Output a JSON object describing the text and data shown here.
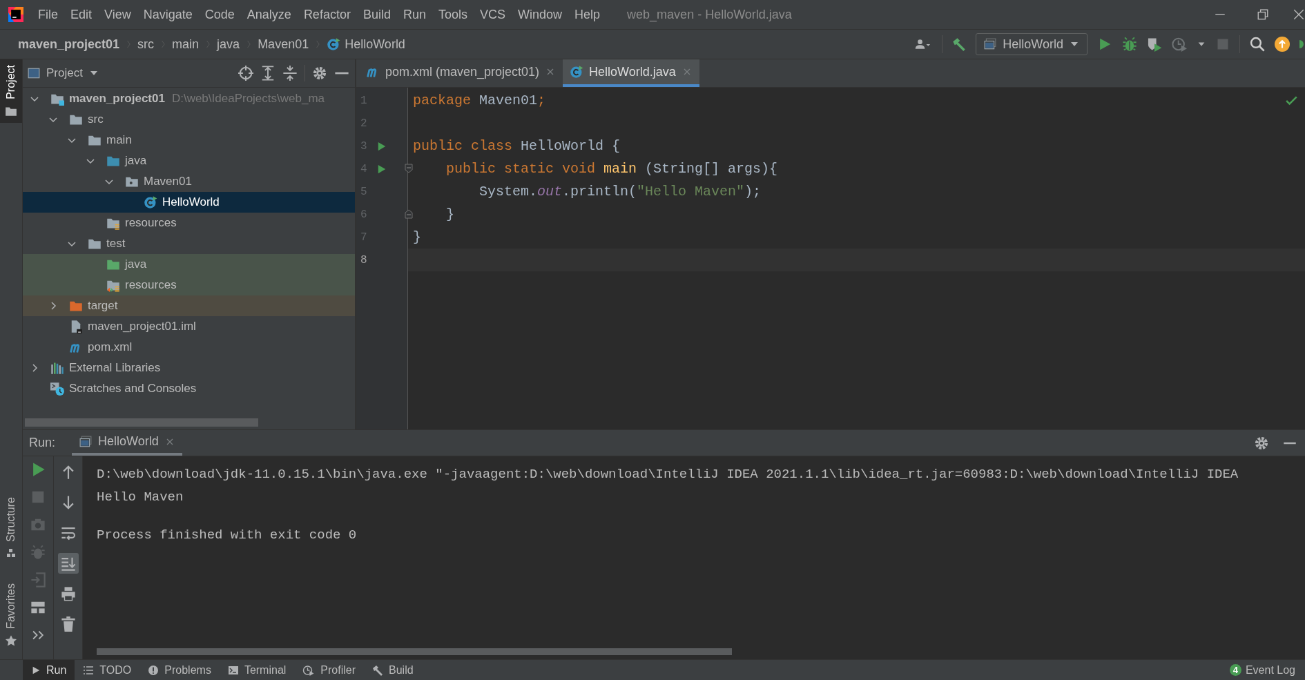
{
  "window": {
    "title": "web_maven - HelloWorld.java"
  },
  "menu": [
    "File",
    "Edit",
    "View",
    "Navigate",
    "Code",
    "Analyze",
    "Refactor",
    "Build",
    "Run",
    "Tools",
    "VCS",
    "Window",
    "Help"
  ],
  "breadcrumbs": [
    {
      "label": "maven_project01",
      "kind": "module"
    },
    {
      "label": "src",
      "kind": "folder"
    },
    {
      "label": "main",
      "kind": "folder"
    },
    {
      "label": "java",
      "kind": "folder"
    },
    {
      "label": "Maven01",
      "kind": "folder"
    },
    {
      "label": "HelloWorld",
      "kind": "class"
    }
  ],
  "toolbar": {
    "run_config": "HelloWorld"
  },
  "left_stripe": {
    "top": [
      {
        "label": "Project",
        "kind": "project",
        "selected": true
      }
    ],
    "bottom": [
      {
        "label": "Structure",
        "kind": "structure",
        "selected": false
      },
      {
        "label": "Favorites",
        "kind": "favorites",
        "selected": false
      }
    ]
  },
  "project_panel": {
    "title": "Project",
    "tree": [
      {
        "label": "maven_project01",
        "kind": "module",
        "path": "D:\\web\\IdeaProjects\\web_ma",
        "expanded": true,
        "selected": false,
        "children": [
          {
            "label": "src",
            "kind": "folder",
            "expanded": true,
            "selected": false,
            "children": [
              {
                "label": "main",
                "kind": "folder",
                "expanded": true,
                "selected": false,
                "children": [
                  {
                    "label": "java",
                    "kind": "source_root",
                    "expanded": true,
                    "selected": false,
                    "children": [
                      {
                        "label": "Maven01",
                        "kind": "package",
                        "expanded": true,
                        "selected": false,
                        "children": [
                          {
                            "label": "HelloWorld",
                            "kind": "class",
                            "selected": true
                          }
                        ]
                      }
                    ]
                  },
                  {
                    "label": "resources",
                    "kind": "resources_root",
                    "selected": false
                  }
                ]
              },
              {
                "label": "test",
                "kind": "folder",
                "expanded": true,
                "selected": false,
                "children": [
                  {
                    "label": "java",
                    "kind": "test_root",
                    "selected": false
                  },
                  {
                    "label": "resources",
                    "kind": "test_resources_root",
                    "selected": false
                  }
                ]
              }
            ]
          },
          {
            "label": "target",
            "kind": "excluded",
            "expanded": false,
            "selected": false
          },
          {
            "label": "maven_project01.iml",
            "kind": "iml",
            "selected": false
          },
          {
            "label": "pom.xml",
            "kind": "maven",
            "selected": false
          }
        ]
      },
      {
        "label": "External Libraries",
        "kind": "libraries",
        "expanded": false,
        "selected": false
      },
      {
        "label": "Scratches and Consoles",
        "kind": "scratches",
        "selected": false
      }
    ]
  },
  "editor": {
    "tabs": [
      {
        "label": "pom.xml (maven_project01)",
        "kind": "maven",
        "selected": false
      },
      {
        "label": "HelloWorld.java",
        "kind": "class",
        "selected": true
      }
    ],
    "lines": [
      {
        "number": "1",
        "run_marker": false,
        "current": false,
        "fold_start": false,
        "fold_end": false,
        "tokens": [
          {
            "text": "package",
            "kind": "keyword"
          },
          {
            "text": " Maven01",
            "kind": "plain"
          },
          {
            "text": ";",
            "kind": "keyword"
          }
        ]
      },
      {
        "number": "2",
        "run_marker": false,
        "current": false,
        "fold_start": false,
        "fold_end": false
      },
      {
        "number": "3",
        "run_marker": true,
        "current": false,
        "fold_start": false,
        "fold_end": false,
        "tokens": [
          {
            "text": "public class",
            "kind": "keyword"
          },
          {
            "text": " HelloWorld {",
            "kind": "plain"
          }
        ]
      },
      {
        "number": "4",
        "run_marker": true,
        "current": false,
        "fold_start": true,
        "fold_end": false,
        "tokens": [
          {
            "text": "    public static void",
            "kind": "keyword"
          },
          {
            "text": " main",
            "kind": "method"
          },
          {
            "text": " (String[] args){",
            "kind": "plain"
          }
        ]
      },
      {
        "number": "5",
        "run_marker": false,
        "current": false,
        "fold_start": false,
        "fold_end": false,
        "tokens": [
          {
            "text": "        System.",
            "kind": "plain"
          },
          {
            "text": "out",
            "kind": "field"
          },
          {
            "text": ".println(",
            "kind": "plain"
          },
          {
            "text": "\"Hello Maven\"",
            "kind": "string"
          },
          {
            "text": ");",
            "kind": "plain"
          }
        ]
      },
      {
        "number": "6",
        "run_marker": false,
        "current": false,
        "fold_start": false,
        "fold_end": true,
        "tokens": [
          {
            "text": "    }",
            "kind": "plain"
          }
        ]
      },
      {
        "number": "7",
        "run_marker": false,
        "current": false,
        "fold_start": false,
        "fold_end": false,
        "tokens": [
          {
            "text": "}",
            "kind": "plain"
          }
        ]
      },
      {
        "number": "8",
        "run_marker": false,
        "current": true,
        "fold_start": false,
        "fold_end": false
      }
    ]
  },
  "run_panel": {
    "title": "Run:",
    "tabs": [
      {
        "label": "HelloWorld",
        "selected": true
      }
    ],
    "autoscroll": true,
    "output": [
      {
        "text": "D:\\web\\download\\jdk-11.0.15.1\\bin\\java.exe \"-javaagent:D:\\web\\download\\IntelliJ IDEA 2021.1.1\\lib\\idea_rt.jar=60983:D:\\web\\download\\IntelliJ IDEA",
        "kind": "command"
      },
      {
        "text": "Hello Maven",
        "kind": "output"
      },
      {
        "text": "Process finished with exit code 0",
        "kind": "exit"
      }
    ]
  },
  "status_bar": {
    "tools": [
      {
        "label": "Run",
        "kind": "run",
        "selected": true
      },
      {
        "label": "TODO",
        "kind": "todo",
        "selected": false
      },
      {
        "label": "Problems",
        "kind": "problems",
        "selected": false
      },
      {
        "label": "Terminal",
        "kind": "terminal",
        "selected": false
      },
      {
        "label": "Profiler",
        "kind": "profiler",
        "selected": false
      },
      {
        "label": "Build",
        "kind": "build",
        "selected": false
      }
    ],
    "event_log": {
      "label": "Event Log",
      "count": "4"
    }
  }
}
